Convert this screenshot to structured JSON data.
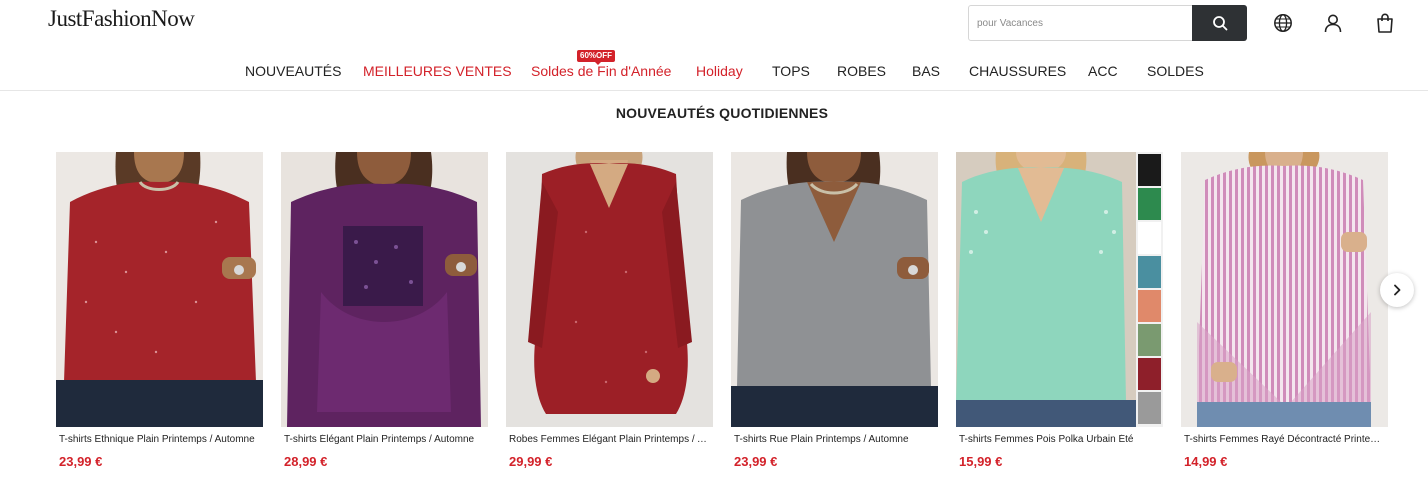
{
  "header": {
    "logo": "JustFashionNow",
    "search": {
      "placeholder": "pour Vacances",
      "button_icon": "search-icon"
    },
    "icons": [
      "globe-icon",
      "user-icon",
      "shopping-bag-icon"
    ]
  },
  "nav": {
    "promo_badge": "60%OFF",
    "items": [
      {
        "label": "NOUVEAUTÉS",
        "color": "#222222"
      },
      {
        "label": "MEILLEURES VENTES",
        "color": "#d3222a"
      },
      {
        "label": "Soldes de Fin d'Année",
        "color": "#d3222a"
      },
      {
        "label": "Holiday",
        "color": "#d3222a"
      },
      {
        "label": "TOPS",
        "color": "#222222"
      },
      {
        "label": "ROBES",
        "color": "#222222"
      },
      {
        "label": "BAS",
        "color": "#222222"
      },
      {
        "label": "CHAUSSURES",
        "color": "#222222"
      },
      {
        "label": "ACC",
        "color": "#222222"
      },
      {
        "label": "SOLDES",
        "color": "#222222"
      }
    ]
  },
  "section": {
    "title": "NOUVEAUTÉS QUOTIDIENNES",
    "products": [
      {
        "name": "T-shirts Ethnique Plain Printemps / Automne",
        "price": "23,99 €",
        "color": "#a5242a"
      },
      {
        "name": "T-shirts Élégant Plain Printemps / Automne",
        "price": "28,99 €",
        "color": "#5e2360"
      },
      {
        "name": "Robes Femmes Élégant Plain Printemps / Automne",
        "price": "29,99 €",
        "color": "#9c1f26"
      },
      {
        "name": "T-shirts Rue Plain Printemps / Automne",
        "price": "23,99 €",
        "color": "#8f9194"
      },
      {
        "name": "T-shirts Femmes Pois Polka Urbain Été",
        "price": "15,99 €",
        "color": "#8ed6bd"
      },
      {
        "name": "T-shirts Femmes Rayé Décontracté Printemps",
        "price": "14,99 €",
        "color": "#d9a2c6"
      }
    ],
    "next_icon": "chevron-right-icon"
  },
  "colors": {
    "accent_red": "#d3222a",
    "search_button": "#2e3134"
  }
}
